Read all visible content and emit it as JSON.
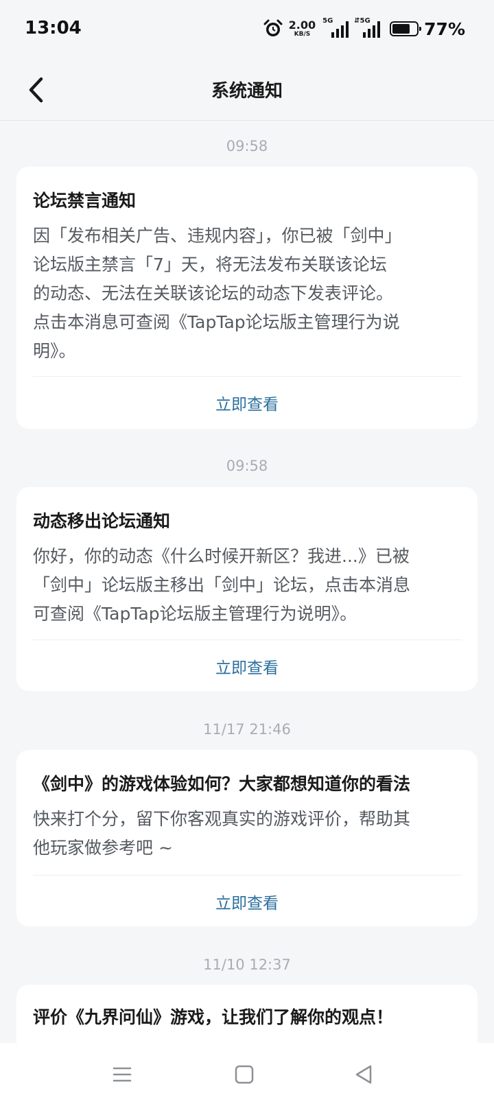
{
  "status_bar": {
    "time": "13:04",
    "net_speed_value": "2.00",
    "net_speed_unit": "KB/S",
    "sim1_tag": "5G",
    "sim2_tag": "⇵5G",
    "battery_percent": "77%",
    "battery_level": 0.77,
    "icons": [
      "alarm-icon",
      "signal-icon",
      "signal-icon",
      "battery-icon"
    ]
  },
  "header": {
    "title": "系统通知",
    "back_icon": "chevron-left-icon"
  },
  "notifications": [
    {
      "time": "09:58",
      "title": "论坛禁言通知",
      "body_lines": [
        "因「发布相关广告、违规内容」，你已被「剑中」",
        "论坛版主禁言「7」天，将无法发布关联该论坛",
        "的动态、无法在关联该论坛的动态下发表评论。",
        "点击本消息可查阅《TapTap论坛版主管理行为说",
        "明》。"
      ],
      "action": "立即查看"
    },
    {
      "time": "09:58",
      "title": "动态移出论坛通知",
      "body_lines": [
        "你好，你的动态《什么时候开新区？我进...》已被",
        "「剑中」论坛版主移出「剑中」论坛，点击本消息",
        "可查阅《TapTap论坛版主管理行为说明》。"
      ],
      "action": "立即查看"
    },
    {
      "time": "11/17  21:46",
      "title": "《剑中》的游戏体验如何？大家都想知道你的看法",
      "body_lines": [
        "快来打个分，留下你客观真实的游戏评价，帮助其",
        "他玩家做参考吧 ~"
      ],
      "action": "立即查看"
    },
    {
      "time": "11/10  12:37",
      "title": "评价《九界问仙》游戏，让我们了解你的观点！",
      "body_lines": [],
      "action": ""
    }
  ],
  "bottom_nav": {
    "icons": [
      "menu-icon",
      "home-square-icon",
      "back-triangle-icon"
    ]
  }
}
